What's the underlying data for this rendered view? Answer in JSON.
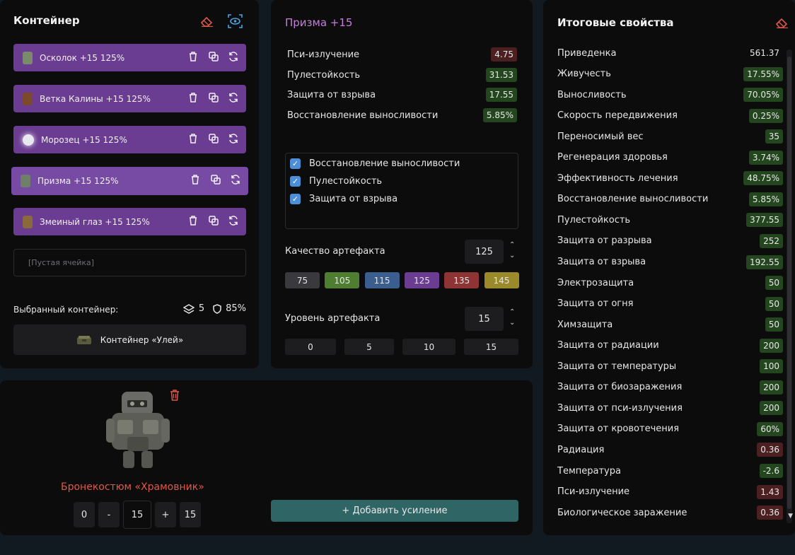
{
  "container": {
    "title": "Контейнер",
    "artifacts": [
      {
        "label": "Осколок +15  125%",
        "color": "#7a8a6a"
      },
      {
        "label": "Ветка Калины +15  125%",
        "color": "#7a4a2a"
      },
      {
        "label": "Морозец +15  125%",
        "color": "#e8e8f0"
      },
      {
        "label": "Призма +15  125%",
        "color": "#6f7f6a"
      },
      {
        "label": "Змеиный глаз +15  125%",
        "color": "#8a6a3a"
      }
    ],
    "empty_cell": "[Пустая ячейка]",
    "selected_label": "Выбранный контейнер:",
    "slots": "5",
    "protection": "85%",
    "container_name": "Контейнер «Улей»"
  },
  "prism": {
    "title": "Призма +15",
    "stats": [
      {
        "label": "Пси-излучение",
        "value": "4.75",
        "kind": "red"
      },
      {
        "label": "Пулестойкость",
        "value": "31.53",
        "kind": "green"
      },
      {
        "label": "Защита от взрыва",
        "value": "17.55",
        "kind": "green"
      },
      {
        "label": "Восстановление выносливости",
        "value": "5.85%",
        "kind": "green"
      }
    ],
    "checks": [
      {
        "label": "Восстановление выносливости",
        "checked": true
      },
      {
        "label": "Пулестойкость",
        "checked": true
      },
      {
        "label": "Защита от взрыва",
        "checked": true
      }
    ],
    "quality_label": "Качество артефакта",
    "quality_value": "125",
    "quality_options": [
      {
        "label": "75",
        "color": "#3a3a3e"
      },
      {
        "label": "105",
        "color": "#4f7d32"
      },
      {
        "label": "115",
        "color": "#3a5f8f"
      },
      {
        "label": "125",
        "color": "#6b3d92"
      },
      {
        "label": "135",
        "color": "#8f3434"
      },
      {
        "label": "145",
        "color": "#9a8a2a"
      }
    ],
    "level_label": "Уровень артефакта",
    "level_value": "15",
    "level_options": [
      "0",
      "5",
      "10",
      "15"
    ]
  },
  "armor": {
    "name": "Бронекостюм «Храмовник»",
    "min": "0",
    "minus": "-",
    "value": "15",
    "plus": "+",
    "max": "15",
    "add_label": "+ Добавить усиление"
  },
  "totals": {
    "title": "Итоговые свойства",
    "rows": [
      {
        "label": "Приведенка",
        "value": "561.37",
        "kind": "plain"
      },
      {
        "label": "Живучесть",
        "value": "17.55%",
        "kind": "green"
      },
      {
        "label": "Выносливость",
        "value": "70.05%",
        "kind": "green"
      },
      {
        "label": "Скорость передвижения",
        "value": "0.25%",
        "kind": "green"
      },
      {
        "label": "Переносимый вес",
        "value": "35",
        "kind": "green"
      },
      {
        "label": "Регенерация здоровья",
        "value": "3.74%",
        "kind": "green"
      },
      {
        "label": "Эффективность лечения",
        "value": "48.75%",
        "kind": "green"
      },
      {
        "label": "Восстановление выносливости",
        "value": "5.85%",
        "kind": "green"
      },
      {
        "label": "Пулестойкость",
        "value": "377.55",
        "kind": "green"
      },
      {
        "label": "Защита от разрыва",
        "value": "252",
        "kind": "green"
      },
      {
        "label": "Защита от взрыва",
        "value": "192.55",
        "kind": "green"
      },
      {
        "label": "Электрозащита",
        "value": "50",
        "kind": "green"
      },
      {
        "label": "Защита от огня",
        "value": "50",
        "kind": "green"
      },
      {
        "label": "Химзащита",
        "value": "50",
        "kind": "green"
      },
      {
        "label": "Защита от радиации",
        "value": "200",
        "kind": "green"
      },
      {
        "label": "Защита от температуры",
        "value": "100",
        "kind": "green"
      },
      {
        "label": "Защита от биозаражения",
        "value": "200",
        "kind": "green"
      },
      {
        "label": "Защита от пси-излучения",
        "value": "200",
        "kind": "green"
      },
      {
        "label": "Защита от кровотечения",
        "value": "60%",
        "kind": "green"
      },
      {
        "label": "Радиация",
        "value": "0.36",
        "kind": "red"
      },
      {
        "label": "Температура",
        "value": "-2.6",
        "kind": "green"
      },
      {
        "label": "Пси-излучение",
        "value": "1.43",
        "kind": "red"
      },
      {
        "label": "Биологическое заражение",
        "value": "0.36",
        "kind": "red"
      }
    ]
  }
}
